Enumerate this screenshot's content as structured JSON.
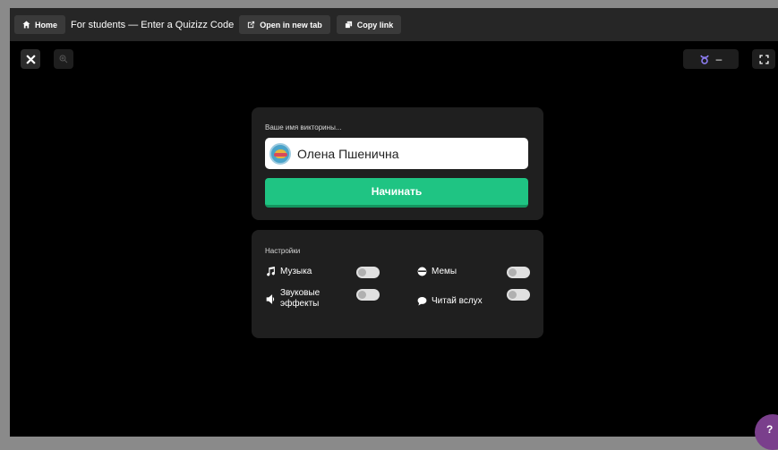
{
  "topbar": {
    "home_label": "Home",
    "description": "For students — Enter a Quizizz Code",
    "open_tab_label": "Open in new tab",
    "copy_link_label": "Copy link"
  },
  "controls": {
    "theme_value": "–"
  },
  "name_card": {
    "label": "Ваше имя викторины...",
    "name_value": "Олена Пшенична",
    "start_label": "Начинать"
  },
  "settings": {
    "title": "Настройки",
    "music_label": "Музыка",
    "memes_label": "Мемы",
    "sound_label_line1": "Звуковые",
    "sound_label_line2": "эффекты",
    "read_aloud_label": "Читай вслух"
  },
  "colors": {
    "accent": "#1fc483",
    "background": "#000000",
    "card": "#1f1f1f",
    "topbar": "#262626"
  }
}
